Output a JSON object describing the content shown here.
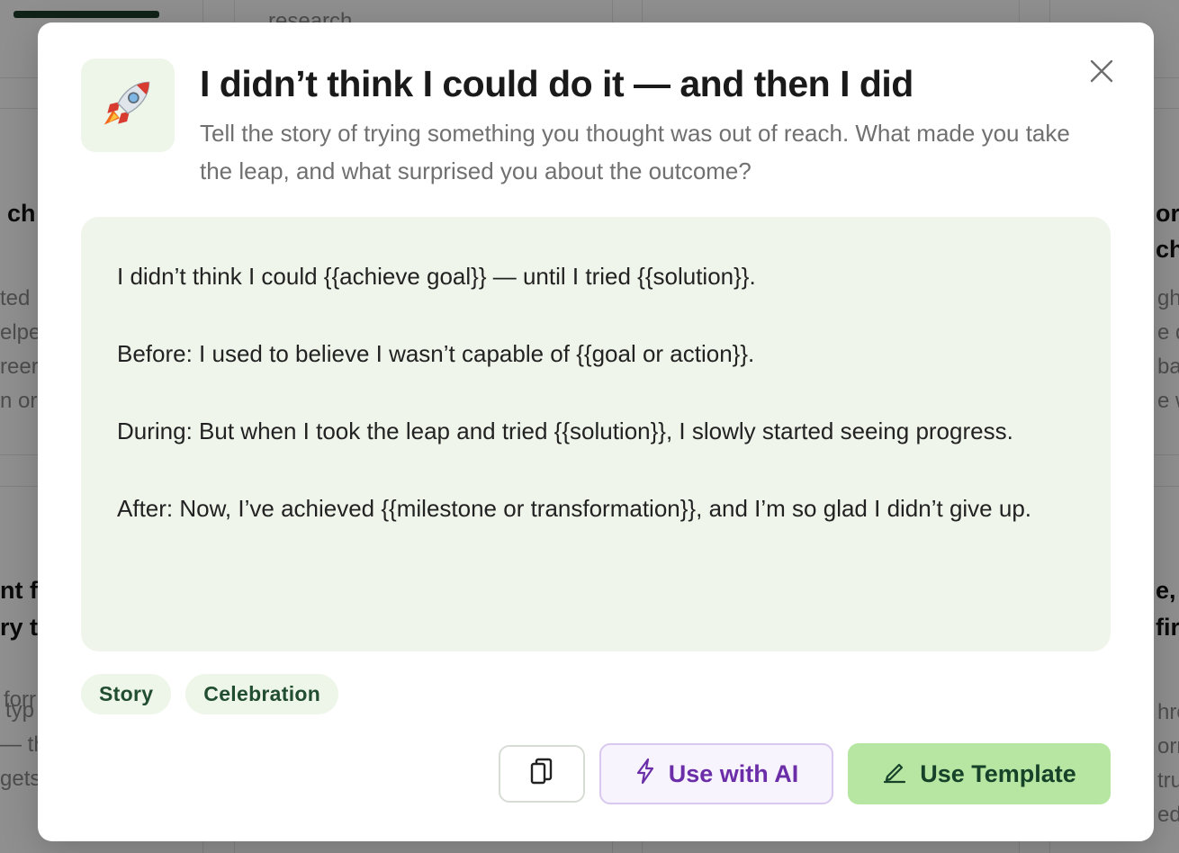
{
  "background": {
    "snippets": [
      "research",
      "ch",
      "ted",
      "elpe",
      "reer",
      "n or",
      "nt f",
      "ry t",
      "forr",
      "typ",
      "— th",
      "gets",
      "or",
      "ch",
      "ght",
      "e de",
      "bac",
      "e w",
      "e,",
      "fir",
      "hro",
      "orn",
      "tru",
      "ed"
    ]
  },
  "modal": {
    "icon": "rocket-icon",
    "emoji": "🚀",
    "title": "I didn’t think I could do it — and then I did",
    "subtitle": "Tell the story of trying something you thought was out of reach. What made you take the leap, and what surprised you about the outcome?",
    "template_lines": [
      "I didn’t think I could {{achieve goal}} — until I tried {{solution}}.",
      "Before: I used to believe I wasn’t capable of {{goal or action}}.",
      "During: But when I took the leap and tried {{solution}}, I slowly started seeing progress.",
      "After: Now, I’ve achieved {{milestone or transformation}}, and I’m so glad I didn’t give up."
    ],
    "tags": [
      "Story",
      "Celebration"
    ],
    "buttons": {
      "copy_icon": "copy-icon",
      "ai_label": "Use with AI",
      "ai_icon": "lightning-icon",
      "template_label": "Use Template",
      "template_icon": "pencil-icon"
    }
  },
  "colors": {
    "accent_green": "#b6e6a2",
    "template_bg": "#eff5ea",
    "ai_purple": "#6b2ea8"
  }
}
